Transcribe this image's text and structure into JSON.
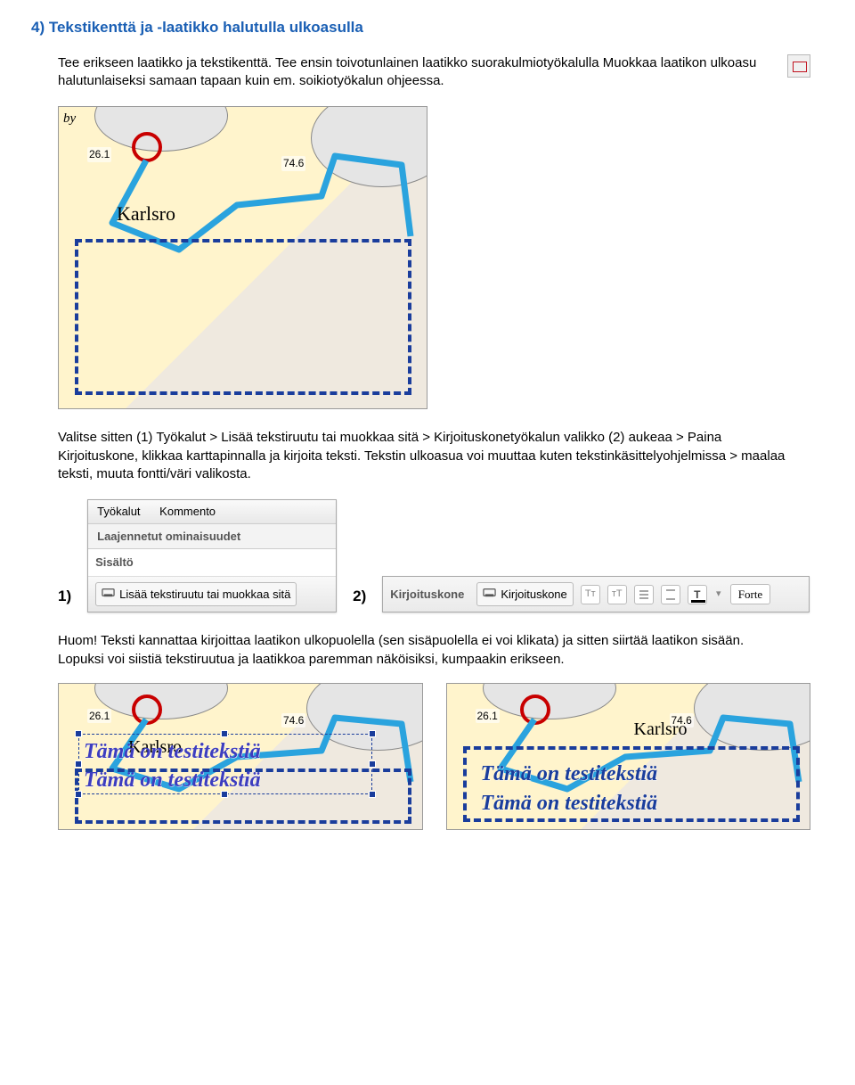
{
  "heading": "4)  Tekstikenttä ja -laatikko halutulla ulkoasulla",
  "para1": "Tee erikseen laatikko ja tekstikenttä. Tee ensin toivotunlainen laatikko suorakulmiotyökalulla Muokkaa laatikon ulkoasu halutunlaiseksi samaan tapaan kuin em. soikiotyökalun ohjeessa.",
  "map1": {
    "place": "Karlsro",
    "num1": "26.1",
    "num2": "74.6",
    "by": "by"
  },
  "para2": "Valitse sitten (1) Työkalut > Lisää tekstiruutu tai muokkaa sitä > Kirjoituskonetyökalun valikko (2) aukeaa > Paina Kirjoituskone, klikkaa karttapinnalla ja kirjoita teksti. Tekstin ulkoasua voi muuttaa kuten tekstinkäsittelyohjelmissa > maalaa teksti,  muuta fontti/väri valikosta.",
  "toolLabels": {
    "one": "1)",
    "two": "2)"
  },
  "tool1": {
    "menu1": "Työkalut",
    "menu2": "Kommento",
    "sub": "Laajennetut ominaisuudet",
    "row": "Sisältö",
    "btn": "Lisää tekstiruutu tai muokkaa sitä"
  },
  "tool2": {
    "header": "Kirjoituskone",
    "btn": "Kirjoituskone",
    "font": "Forte"
  },
  "para3a": "Huom! Teksti kannattaa kirjoittaa laatikon ulkopuolella (sen sisäpuolella ei voi klikata) ja sitten siirtää laatikon sisään. Lopuksi voi siistiä tekstiruutua ja laatikkoa paremman näköisiksi, kumpaakin erikseen.",
  "mapSmall": {
    "place": "Karlsro",
    "num1": "26.1",
    "num2": "74.6",
    "testi": "Tämä on testitekstiä"
  }
}
